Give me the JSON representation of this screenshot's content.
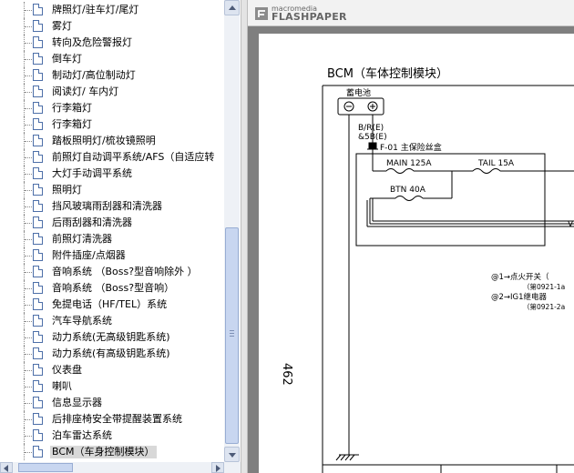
{
  "tree": {
    "items": [
      {
        "label": "牌照灯/驻车灯/尾灯"
      },
      {
        "label": "雾灯"
      },
      {
        "label": "转向及危险警报灯"
      },
      {
        "label": "倒车灯"
      },
      {
        "label": "制动灯/高位制动灯"
      },
      {
        "label": "阅读灯/ 车内灯"
      },
      {
        "label": "行李箱灯"
      },
      {
        "label": "行李箱灯"
      },
      {
        "label": "踏板照明灯/梳妆镜照明"
      },
      {
        "label": "前照灯自动调平系统/AFS（自适应转"
      },
      {
        "label": "大灯手动调平系统"
      },
      {
        "label": "照明灯"
      },
      {
        "label": "挡风玻璃雨刮器和清洗器"
      },
      {
        "label": "后雨刮器和清洗器"
      },
      {
        "label": "前照灯清洗器"
      },
      {
        "label": "附件插座/点烟器"
      },
      {
        "label": "音响系统  （Boss?型音响除外 ）"
      },
      {
        "label": "音响系统  （Boss?型音响）"
      },
      {
        "label": "免提电话（HF/TEL）系统"
      },
      {
        "label": "汽车导航系统"
      },
      {
        "label": "动力系统(无高级钥匙系统)"
      },
      {
        "label": "动力系统(有高级钥匙系统)"
      },
      {
        "label": "仪表盘"
      },
      {
        "label": "喇叭"
      },
      {
        "label": "信息显示器"
      },
      {
        "label": "后排座椅安全带提醒装置系统"
      },
      {
        "label": "泊车雷达系统"
      },
      {
        "label": "BCM（车身控制模块）",
        "selected": true
      }
    ]
  },
  "viewer": {
    "logo_small": "macromedia",
    "logo_big": "FLASHPAPER",
    "page": {
      "title": "BCM（车体控制模块）",
      "page_number": "462",
      "battery_label": "蓄电池",
      "battery_minus": "⊖",
      "battery_plus": "⊕",
      "wire_label_1": "B/R(E)",
      "wire_label_2": "&5B(E)",
      "fuse_box_label": "F-01 主保险丝盒",
      "fuse_main": "MAIN 125A",
      "fuse_tail": "TAIL 15A",
      "fuse_btn": "BTN 40A",
      "wire_end": "V",
      "note_1": "@1→点火开关（",
      "note_1_sub": "（第0921-1a",
      "note_2": "@2→IG1继电器",
      "note_2_sub": "（第0921-2a"
    }
  },
  "colors": {
    "selection": "#d8d8d8",
    "scrollbar_thumb": "#c8d6f0",
    "viewer_background": "#7f7f7f"
  }
}
